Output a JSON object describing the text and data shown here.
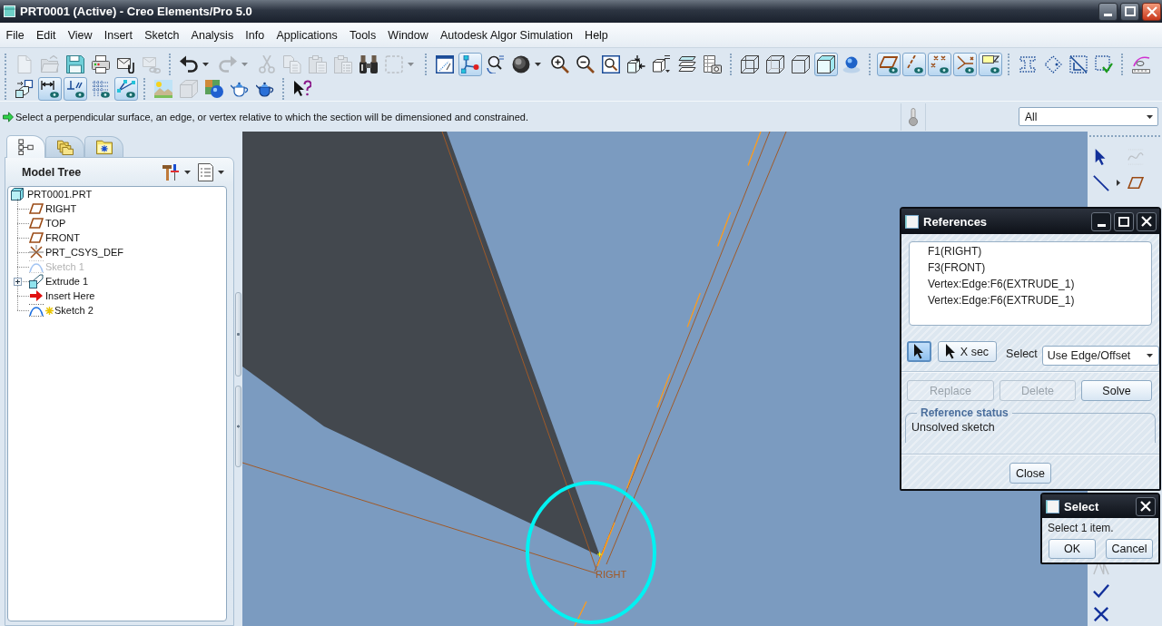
{
  "window": {
    "title": "PRT0001 (Active) - Creo Elements/Pro 5.0"
  },
  "menu_bar": [
    "File",
    "Edit",
    "View",
    "Insert",
    "Sketch",
    "Analysis",
    "Info",
    "Applications",
    "Tools",
    "Window",
    "Autodesk Algor Simulation",
    "Help"
  ],
  "toolbar": {
    "row_1": [
      [
        {
          "pressed": false,
          "disabled": true
        },
        {
          "pressed": false,
          "disabled": true
        },
        {
          "pressed": false,
          "disabled": false
        },
        {
          "pressed": false,
          "disabled": false
        },
        {
          "pressed": false,
          "disabled": false
        },
        {
          "pressed": false,
          "disabled": true
        }
      ],
      [
        {
          "pressed": false,
          "disabled": false
        },
        {
          "pressed": false,
          "disabled": true
        },
        {
          "pressed": false,
          "disabled": true
        },
        {
          "pressed": false,
          "disabled": true
        },
        {
          "pressed": false,
          "disabled": true
        },
        {
          "pressed": false,
          "disabled": true
        },
        {
          "pressed": false,
          "disabled": false
        },
        {
          "pressed": false,
          "disabled": true
        }
      ],
      [
        {
          "pressed": false,
          "disabled": false
        },
        {
          "pressed": true,
          "disabled": false
        },
        {
          "pressed": false,
          "disabled": false
        },
        {
          "pressed": false,
          "disabled": false
        },
        {
          "pressed": false,
          "disabled": false
        },
        {
          "pressed": false,
          "disabled": false
        },
        {
          "pressed": false,
          "disabled": false
        },
        {
          "pressed": false,
          "disabled": false
        },
        {
          "pressed": false,
          "disabled": false
        },
        {
          "pressed": false,
          "disabled": false
        },
        {
          "pressed": false,
          "disabled": false
        }
      ],
      [
        {
          "pressed": false,
          "disabled": false
        },
        {
          "pressed": false,
          "disabled": false
        },
        {
          "pressed": false,
          "disabled": false
        },
        {
          "pressed": true,
          "disabled": false
        },
        {
          "pressed": false,
          "disabled": false
        }
      ],
      [
        {
          "pressed": true,
          "disabled": false
        },
        {
          "pressed": true,
          "disabled": false
        },
        {
          "pressed": true,
          "disabled": false
        },
        {
          "pressed": true,
          "disabled": false
        },
        {
          "pressed": true,
          "disabled": false
        }
      ],
      [
        {
          "pressed": false,
          "disabled": false
        },
        {
          "pressed": false,
          "disabled": false
        },
        {
          "pressed": false,
          "disabled": false
        },
        {
          "pressed": false,
          "disabled": false
        }
      ],
      [
        {
          "pressed": false,
          "disabled": false
        }
      ]
    ],
    "row_2": [
      [
        {
          "pressed": false,
          "disabled": false
        },
        {
          "pressed": true,
          "disabled": false
        },
        {
          "pressed": true,
          "disabled": false
        },
        {
          "pressed": false,
          "disabled": false
        },
        {
          "pressed": true,
          "disabled": false
        }
      ],
      [
        {
          "pressed": false,
          "disabled": false
        },
        {
          "pressed": false,
          "disabled": true
        },
        {
          "pressed": false,
          "disabled": false
        },
        {
          "pressed": false,
          "disabled": false
        },
        {
          "pressed": false,
          "disabled": false
        }
      ],
      [
        {
          "pressed": false,
          "disabled": false
        }
      ]
    ]
  },
  "message_bar": {
    "message": "Select a perpendicular surface, an edge, or vertex relative to which the section will be dimensioned and constrained.",
    "filter": "All"
  },
  "navigator": {
    "tabs": [
      {
        "selected": true
      },
      {
        "selected": false
      },
      {
        "selected": false
      }
    ],
    "title": "Model Tree",
    "tree": {
      "label": "PRT0001.PRT",
      "kind": "part",
      "collapsed": false,
      "dimmed": false,
      "active": false,
      "children": [
        {
          "label": "RIGHT",
          "kind": "plane",
          "collapsed": false,
          "dimmed": false,
          "active": false
        },
        {
          "label": "TOP",
          "kind": "plane",
          "collapsed": false,
          "dimmed": false,
          "active": false
        },
        {
          "label": "FRONT",
          "kind": "plane",
          "collapsed": false,
          "dimmed": false,
          "active": false
        },
        {
          "label": "PRT_CSYS_DEF",
          "kind": "csys",
          "collapsed": false,
          "dimmed": false,
          "active": false
        },
        {
          "label": "Sketch 1",
          "kind": "sketch",
          "collapsed": false,
          "dimmed": true,
          "active": false
        },
        {
          "label": "Extrude 1",
          "kind": "extrude",
          "collapsed": true,
          "dimmed": false,
          "active": false
        },
        {
          "label": "Insert Here",
          "kind": "insert",
          "collapsed": false,
          "dimmed": false,
          "active": false
        },
        {
          "label": "Sketch 2",
          "kind": "sketch",
          "collapsed": false,
          "dimmed": false,
          "active": true
        }
      ]
    }
  },
  "graphics": {
    "datum_label": "RIGHT"
  },
  "side_toolbar": {
    "top": [
      {
        "disabled": false
      },
      {
        "disabled": true
      },
      {
        "disabled": false
      },
      {
        "disabled": false
      }
    ],
    "bottom": [
      {
        "disabled": true
      },
      {
        "disabled": false
      },
      {
        "disabled": false
      }
    ]
  },
  "references_dialog": {
    "title": "References",
    "references": [
      "F1(RIGHT)",
      "F3(FRONT)",
      "Vertex:Edge:F6(EXTRUDE_1)",
      "Vertex:Edge:F6(EXTRUDE_1)"
    ],
    "pick_buttons": [
      {
        "pressed": true
      },
      {
        "label": "X sec",
        "pressed": false
      }
    ],
    "select_label": "Select",
    "select_value": "Use Edge/Offset",
    "actions": [
      {
        "label": "Replace",
        "disabled": true
      },
      {
        "label": "Delete",
        "disabled": true
      },
      {
        "label": "Solve",
        "disabled": false
      }
    ],
    "status_title": "Reference status",
    "status": "Unsolved sketch",
    "close_button": "Close"
  },
  "select_dialog": {
    "title": "Select",
    "prompt": "Select 1 item.",
    "buttons": [
      "OK",
      "Cancel"
    ]
  }
}
